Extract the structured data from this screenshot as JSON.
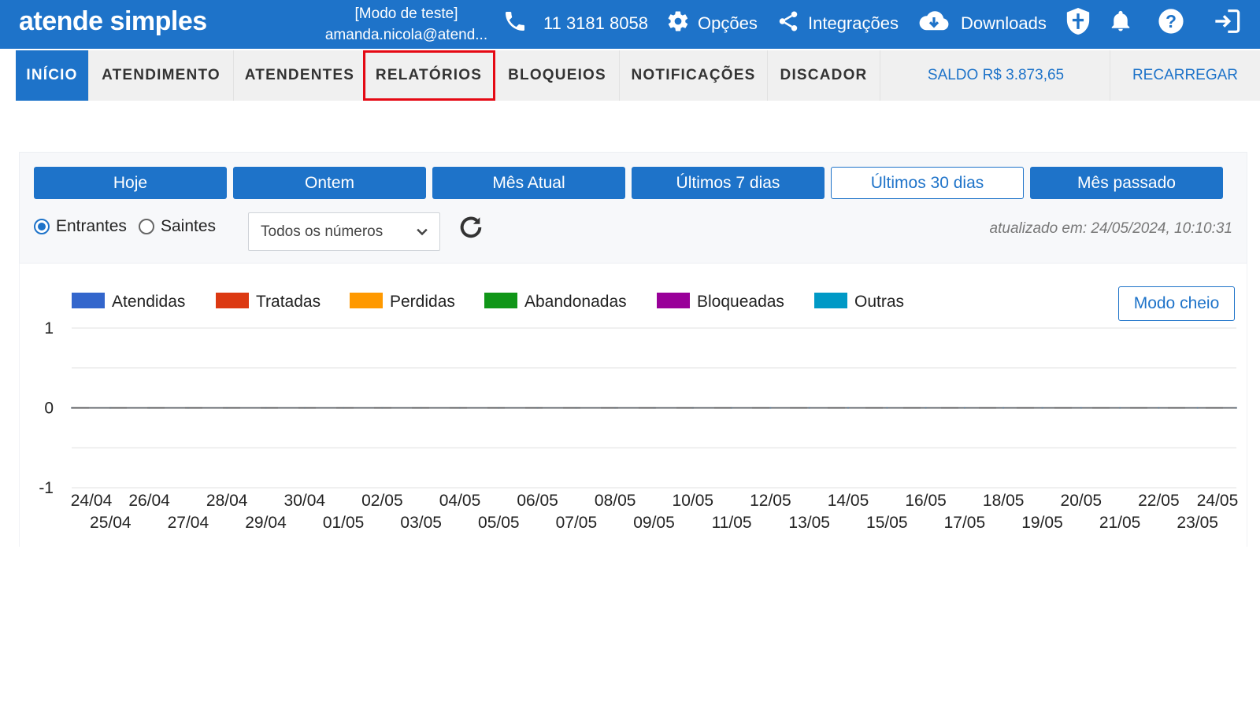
{
  "topbar": {
    "logo": "atende simples",
    "mode_label": "[Modo de teste]",
    "user_email": "amanda.nicola@atend...",
    "phone": "11 3181 8058",
    "options_label": "Opções",
    "integrations_label": "Integrações",
    "downloads_label": "Downloads"
  },
  "nav": {
    "tabs": [
      "INÍCIO",
      "ATENDIMENTO",
      "ATENDENTES",
      "RELATÓRIOS",
      "BLOQUEIOS",
      "NOTIFICAÇÕES",
      "DISCADOR"
    ],
    "active_tab": "INÍCIO",
    "highlighted_tab": "RELATÓRIOS",
    "balance": "SALDO R$ 3.873,65",
    "recharge": "RECARREGAR"
  },
  "filters": {
    "periods": [
      "Hoje",
      "Ontem",
      "Mês Atual",
      "Últimos 7 dias",
      "Últimos 30 dias",
      "Mês passado"
    ],
    "selected_period": "Últimos 30 dias",
    "direction_options": [
      "Entrantes",
      "Saintes"
    ],
    "selected_direction": "Entrantes",
    "number_select": "Todos os números",
    "updated_at": "atualizado em: 24/05/2024, 10:10:31"
  },
  "full_mode_label": "Modo cheio",
  "colors": {
    "primary": "#1e73c9",
    "highlight": "#e50914"
  },
  "chart_data": {
    "type": "line",
    "x": [
      "24/04",
      "25/04",
      "26/04",
      "27/04",
      "28/04",
      "29/04",
      "30/04",
      "01/05",
      "02/05",
      "03/05",
      "04/05",
      "05/05",
      "06/05",
      "07/05",
      "08/05",
      "09/05",
      "10/05",
      "11/05",
      "12/05",
      "13/05",
      "14/05",
      "15/05",
      "16/05",
      "17/05",
      "18/05",
      "19/05",
      "20/05",
      "21/05",
      "22/05",
      "23/05",
      "24/05"
    ],
    "series": [
      {
        "name": "Atendidas",
        "color": "#3366cc",
        "values": [
          0,
          0,
          0,
          0,
          0,
          0,
          0,
          0,
          0,
          0,
          0,
          0,
          0,
          0,
          0,
          0,
          0,
          0,
          0,
          0,
          0,
          0,
          0,
          0,
          0,
          0,
          0,
          0,
          0,
          0,
          0
        ]
      },
      {
        "name": "Tratadas",
        "color": "#dc3912",
        "values": [
          0,
          0,
          0,
          0,
          0,
          0,
          0,
          0,
          0,
          0,
          0,
          0,
          0,
          0,
          0,
          0,
          0,
          0,
          0,
          0,
          0,
          0,
          0,
          0,
          0,
          0,
          0,
          0,
          0,
          0,
          0
        ]
      },
      {
        "name": "Perdidas",
        "color": "#ff9900",
        "values": [
          0,
          0,
          0,
          0,
          0,
          0,
          0,
          0,
          0,
          0,
          0,
          0,
          0,
          0,
          0,
          0,
          0,
          0,
          0,
          0,
          0,
          0,
          0,
          0,
          0,
          0,
          0,
          0,
          0,
          0,
          0
        ]
      },
      {
        "name": "Abandonadas",
        "color": "#109618",
        "values": [
          0,
          0,
          0,
          0,
          0,
          0,
          0,
          0,
          0,
          0,
          0,
          0,
          0,
          0,
          0,
          0,
          0,
          0,
          0,
          0,
          0,
          0,
          0,
          0,
          0,
          0,
          0,
          0,
          0,
          0,
          0
        ]
      },
      {
        "name": "Bloqueadas",
        "color": "#990099",
        "values": [
          0,
          0,
          0,
          0,
          0,
          0,
          0,
          0,
          0,
          0,
          0,
          0,
          0,
          0,
          0,
          0,
          0,
          0,
          0,
          0,
          0,
          0,
          0,
          0,
          0,
          0,
          0,
          0,
          0,
          0,
          0
        ]
      },
      {
        "name": "Outras",
        "color": "#0099c6",
        "values": [
          0,
          0,
          0,
          0,
          0,
          0,
          0,
          0,
          0,
          0,
          0,
          0,
          0,
          0,
          0,
          0,
          0,
          0,
          0,
          0,
          0,
          0,
          0,
          0,
          0,
          0,
          0,
          0,
          0,
          0,
          0
        ]
      }
    ],
    "ylim": [
      -1,
      1
    ],
    "y_ticks": [
      1,
      0,
      -1
    ],
    "grid": true,
    "legend_position": "top"
  }
}
